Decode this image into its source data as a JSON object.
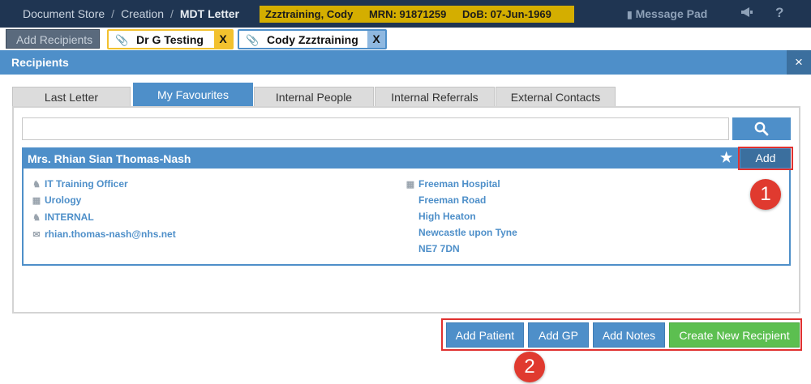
{
  "topbar": {
    "breadcrumb": [
      "Document Store",
      "Creation",
      "MDT Letter"
    ],
    "breadcrumb_sep": "/",
    "patient": {
      "name": "Zzztraining, Cody",
      "mrn": "MRN: 91871259",
      "dob": "DoB: 07-Jun-1969"
    },
    "message_pad_label": "Message Pad",
    "help_label": "?"
  },
  "doc_tabs": {
    "add_recipients_label": "Add Recipients",
    "tabs": [
      {
        "label": "Dr G Testing",
        "close": "X",
        "accent": "#f2c12e"
      },
      {
        "label": "Cody Zzztraining",
        "close": "X",
        "accent": "#4e8fc9"
      }
    ]
  },
  "recipients": {
    "title": "Recipients",
    "close": "×",
    "tabs": [
      "Last Letter",
      "My Favourites",
      "Internal People",
      "Internal Referrals",
      "External Contacts"
    ],
    "active_tab": "My Favourites",
    "search": {
      "value": "",
      "placeholder": ""
    },
    "card": {
      "name": "Mrs. Rhian Sian Thomas-Nash",
      "add_label": "Add",
      "left": [
        "IT Training Officer",
        "Urology",
        "INTERNAL",
        "rhian.thomas-nash@nhs.net"
      ],
      "right": [
        "Freeman Hospital",
        "Freeman Road",
        "High Heaton",
        "Newcastle upon Tyne",
        "NE7 7DN"
      ]
    }
  },
  "actions": {
    "add_patient": "Add Patient",
    "add_gp": "Add GP",
    "add_notes": "Add Notes",
    "create_new_recipient": "Create New Recipient"
  },
  "annotations": {
    "badge1": "1",
    "badge2": "2"
  },
  "colors": {
    "topbar": "#1f3552",
    "patient_banner": "#d4ae00",
    "primary": "#4e8fc9",
    "dark_primary": "#3b6f9e",
    "green": "#5cbf50",
    "highlight": "#e0312f"
  }
}
